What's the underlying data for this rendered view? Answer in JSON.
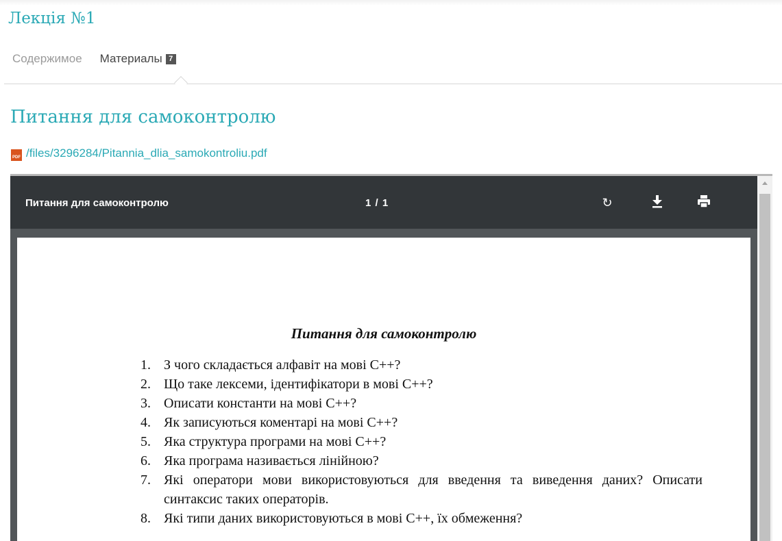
{
  "lecture_title": "Лекція №1",
  "tabs": {
    "content": "Содержимое",
    "materials": "Материалы",
    "materials_count": "7"
  },
  "section_title": "Питання для самоконтролю",
  "file": {
    "icon": "pdf-icon",
    "icon_text": "PDF",
    "path": "/files/3296284/Pitannia_dlia_samokontroliu.pdf"
  },
  "viewer": {
    "title": "Питання для самоконтролю",
    "page_count": "1 / 1",
    "rotate_icon": "↻",
    "download_icon": "⤓",
    "print_icon": "⎙"
  },
  "document": {
    "title": "Питання для самоконтролю",
    "questions": [
      {
        "num": "1.",
        "text": "З чого складається алфавіт на мові С++?"
      },
      {
        "num": "2.",
        "text": "Що таке лексеми, ідентифікатори в мові С++?"
      },
      {
        "num": "3.",
        "text": "Описати константи на мові С++?"
      },
      {
        "num": "4.",
        "text": "Як записуються коментарі на мові С++?"
      },
      {
        "num": "5.",
        "text": "Яка структура програми на мові С++?"
      },
      {
        "num": "6.",
        "text": "Яка програма називається лінійною?"
      },
      {
        "num": "7.",
        "text": "Які оператори мови використовуються для введення та виведення даних? Описати синтаксис таких операторів."
      },
      {
        "num": "8.",
        "text": "Які типи даних використовуються в мові С++, їх обмеження?"
      }
    ]
  },
  "colors": {
    "accent": "#2aa9b5",
    "viewer_toolbar": "#323639",
    "viewer_bg": "#525659"
  }
}
